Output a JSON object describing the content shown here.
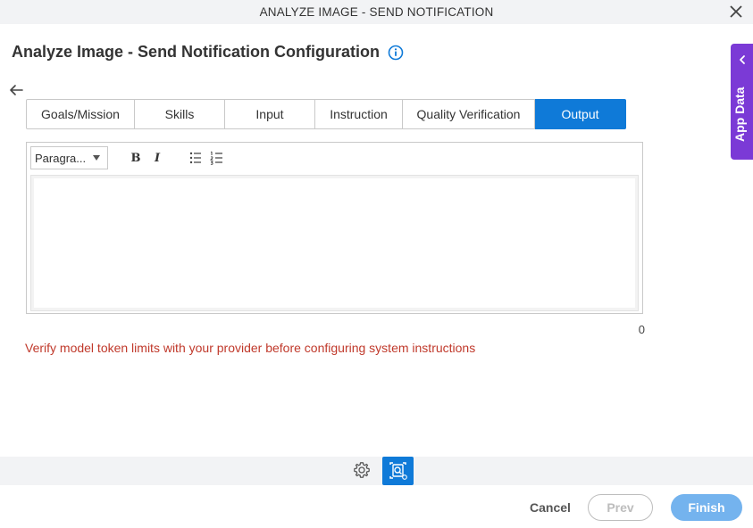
{
  "window": {
    "title": "ANALYZE IMAGE - SEND NOTIFICATION",
    "close_icon": "close-icon"
  },
  "header": {
    "title": "Analyze Image - Send Notification Configuration",
    "info_icon": "info-icon"
  },
  "nav": {
    "back_icon": "arrow-left-icon"
  },
  "tabs": [
    {
      "label": "Goals/Mission",
      "active": false
    },
    {
      "label": "Skills",
      "active": false
    },
    {
      "label": "Input",
      "active": false
    },
    {
      "label": "Instruction",
      "active": false
    },
    {
      "label": "Quality Verification",
      "active": false
    },
    {
      "label": "Output",
      "active": true
    }
  ],
  "editor": {
    "format_select": "Paragra...",
    "bold_label": "B",
    "italic_label": "I",
    "bullet_list_icon": "bulleted-list-icon",
    "numbered_list_icon": "numbered-list-icon",
    "content": ""
  },
  "char_count": "0",
  "warning": "Verify model token limits with your provider before configuring system instructions",
  "side_panel": {
    "label": "App Data",
    "icon": "chevron-left-icon"
  },
  "bottom_toolbar": {
    "settings_icon": "gear-icon",
    "ai_icon": "image-analysis-icon"
  },
  "footer": {
    "cancel_label": "Cancel",
    "prev_label": "Prev",
    "finish_label": "Finish"
  },
  "colors": {
    "accent": "#0f7ad8",
    "side_panel": "#7b3ad6",
    "warning": "#c0392b",
    "finish_disabled": "#74b3ee"
  }
}
